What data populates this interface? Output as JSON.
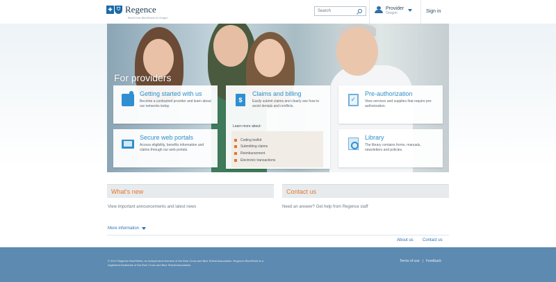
{
  "header": {
    "logo_text": "Regence",
    "logo_tag": "BlueCross BlueShield of Oregon",
    "search_placeholder": "Search",
    "role_label": "Provider",
    "role_sub": "Oregon",
    "signin_label": "Sign in"
  },
  "hero": {
    "title": "For providers",
    "cards": {
      "getting_started": {
        "title": "Getting started with us",
        "desc": "Become a contracted provider and learn about our networks today."
      },
      "claims": {
        "title": "Claims and billing",
        "desc": "Easily submit claims and clearly see how to avoid denials and conflicts.",
        "learn_label": "Learn more about:",
        "items": [
          "Coding toolkit",
          "Submitting claims",
          "Reimbursement",
          "Electronic transactions"
        ]
      },
      "preauth": {
        "title": "Pre-authorization",
        "desc": "View services and supplies that require pre-authorization."
      },
      "secure": {
        "title": "Secure web portals",
        "desc": "Access eligibility, benefits information and claims through our web portals."
      },
      "library": {
        "title": "Library",
        "desc": "The library contains forms, manuals, newsletters and policies."
      }
    }
  },
  "whats_new": {
    "title": "What's new",
    "text": "View important announcements and latest news"
  },
  "contact": {
    "title": "Contact us",
    "text": "Need an answer? Get help from Regence staff"
  },
  "more_info": "More information",
  "bottom_links": {
    "about": "About us",
    "contact": "Contact us"
  },
  "footer": {
    "legal": "© 2014 Regence BlueShield, an independent licensee of the Blue Cross and Blue Shield Association. Regence BlueShield is a registered trademark of the Blue Cross and Blue Shield Association.",
    "terms": "Terms of use",
    "divider": "|",
    "feedback": "Feedback"
  }
}
